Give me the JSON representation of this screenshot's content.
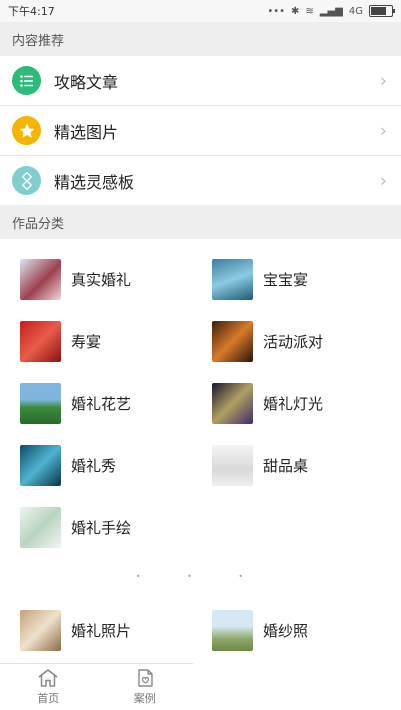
{
  "status_bar": {
    "time": "下午4:17",
    "network": "4G"
  },
  "sections": {
    "recommend": "内容推荐",
    "categories": "作品分类"
  },
  "recommend": [
    {
      "label": "攻略文章",
      "icon": "list-icon",
      "color": "#2dbb7a"
    },
    {
      "label": "精选图片",
      "icon": "star-icon",
      "color": "#f5b400"
    },
    {
      "label": "精选灵感板",
      "icon": "diamond-icon",
      "color": "#7fcfd1"
    }
  ],
  "categories": [
    {
      "label": "真实婚礼",
      "icon": "wedding-photo"
    },
    {
      "label": "宝宝宴",
      "icon": "baby-banquet-photo"
    },
    {
      "label": "寿宴",
      "icon": "birthday-banquet-photo"
    },
    {
      "label": "活动派对",
      "icon": "party-photo"
    },
    {
      "label": "婚礼花艺",
      "icon": "floral-photo"
    },
    {
      "label": "婚礼灯光",
      "icon": "lighting-photo"
    },
    {
      "label": "婚礼秀",
      "icon": "wedding-show-photo"
    },
    {
      "label": "甜品桌",
      "icon": "dessert-table-photo"
    },
    {
      "label": "婚礼手绘",
      "icon": "hand-drawing-photo"
    }
  ],
  "more_categories": [
    {
      "label": "婚礼照片",
      "icon": "wedding-photo-icon"
    },
    {
      "label": "婚纱照",
      "icon": "bridal-photo-icon"
    }
  ],
  "tabs": [
    {
      "label": "首页",
      "icon": "home-icon"
    },
    {
      "label": "案例",
      "icon": "case-heart-icon"
    }
  ],
  "colors": {
    "section_bg": "#eeeeee",
    "divider": "#e6e6e6",
    "accent_green": "#2dbb7a"
  }
}
